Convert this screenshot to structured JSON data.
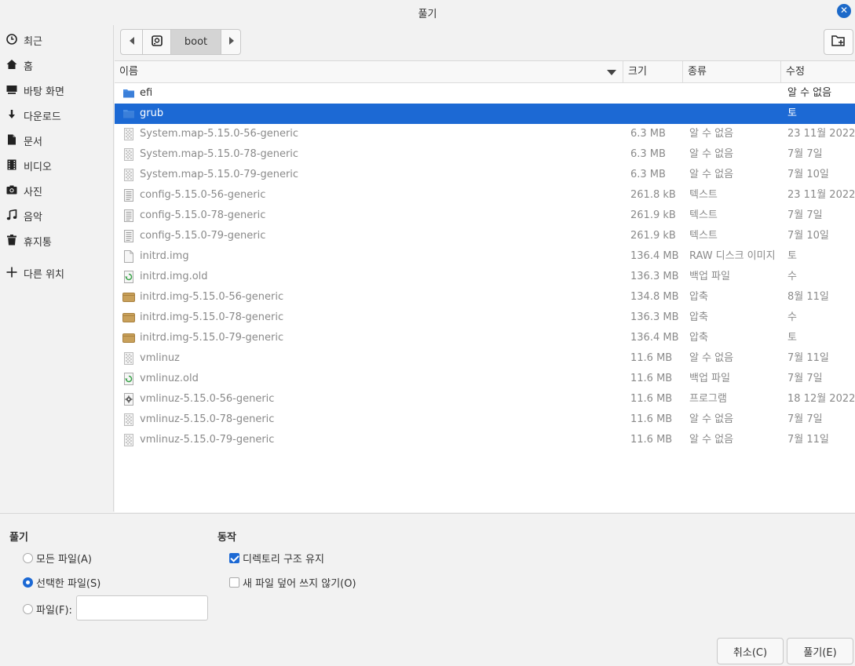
{
  "window": {
    "title": "풀기"
  },
  "sidebar": {
    "items": [
      {
        "label": "최근",
        "icon": "clock-icon"
      },
      {
        "label": "홈",
        "icon": "home-icon"
      },
      {
        "label": "바탕 화면",
        "icon": "desktop-icon"
      },
      {
        "label": "다운로드",
        "icon": "download-icon"
      },
      {
        "label": "문서",
        "icon": "document-icon"
      },
      {
        "label": "비디오",
        "icon": "video-icon"
      },
      {
        "label": "사진",
        "icon": "camera-icon"
      },
      {
        "label": "음악",
        "icon": "music-icon"
      },
      {
        "label": "휴지통",
        "icon": "trash-icon"
      },
      {
        "label": "다른 위치",
        "icon": "plus-icon"
      }
    ]
  },
  "pathbar": {
    "current": "boot"
  },
  "columns": {
    "name": "이름",
    "size": "크기",
    "type": "종류",
    "modified": "수정"
  },
  "files": [
    {
      "name": "efi",
      "size": "",
      "type": "",
      "modified": "알 수 없음",
      "icon": "folder-icon",
      "kind": "dir",
      "selected": false
    },
    {
      "name": "grub",
      "size": "",
      "type": "",
      "modified": "토",
      "icon": "folder-icon",
      "kind": "dir",
      "selected": true
    },
    {
      "name": "System.map-5.15.0-56-generic",
      "size": "6.3 MB",
      "type": "알 수 없음",
      "modified": "23 11월 2022",
      "icon": "unknown-file-icon",
      "kind": "file",
      "selected": false
    },
    {
      "name": "System.map-5.15.0-78-generic",
      "size": "6.3 MB",
      "type": "알 수 없음",
      "modified": " 7월 7일",
      "icon": "unknown-file-icon",
      "kind": "file",
      "selected": false
    },
    {
      "name": "System.map-5.15.0-79-generic",
      "size": "6.3 MB",
      "type": "알 수 없음",
      "modified": " 7월 10일",
      "icon": "unknown-file-icon",
      "kind": "file",
      "selected": false
    },
    {
      "name": "config-5.15.0-56-generic",
      "size": "261.8 kB",
      "type": "텍스트",
      "modified": "23 11월 2022",
      "icon": "text-file-icon",
      "kind": "file",
      "selected": false
    },
    {
      "name": "config-5.15.0-78-generic",
      "size": "261.9 kB",
      "type": "텍스트",
      "modified": " 7월 7일",
      "icon": "text-file-icon",
      "kind": "file",
      "selected": false
    },
    {
      "name": "config-5.15.0-79-generic",
      "size": "261.9 kB",
      "type": "텍스트",
      "modified": " 7월 10일",
      "icon": "text-file-icon",
      "kind": "file",
      "selected": false
    },
    {
      "name": "initrd.img",
      "size": "136.4 MB",
      "type": "RAW 디스크 이미지",
      "modified": "토",
      "icon": "blank-file-icon",
      "kind": "file",
      "selected": false
    },
    {
      "name": "initrd.img.old",
      "size": "136.3 MB",
      "type": "백업 파일",
      "modified": "수",
      "icon": "backup-file-icon",
      "kind": "file",
      "selected": false
    },
    {
      "name": "initrd.img-5.15.0-56-generic",
      "size": "134.8 MB",
      "type": "압축",
      "modified": " 8월 11일",
      "icon": "archive-icon",
      "kind": "file",
      "selected": false
    },
    {
      "name": "initrd.img-5.15.0-78-generic",
      "size": "136.3 MB",
      "type": "압축",
      "modified": "수",
      "icon": "archive-icon",
      "kind": "file",
      "selected": false
    },
    {
      "name": "initrd.img-5.15.0-79-generic",
      "size": "136.4 MB",
      "type": "압축",
      "modified": "토",
      "icon": "archive-icon",
      "kind": "file",
      "selected": false
    },
    {
      "name": "vmlinuz",
      "size": "11.6 MB",
      "type": "알 수 없음",
      "modified": " 7월 11일",
      "icon": "unknown-file-icon",
      "kind": "file",
      "selected": false
    },
    {
      "name": "vmlinuz.old",
      "size": "11.6 MB",
      "type": "백업 파일",
      "modified": " 7월 7일",
      "icon": "backup-file-icon",
      "kind": "file",
      "selected": false
    },
    {
      "name": "vmlinuz-5.15.0-56-generic",
      "size": "11.6 MB",
      "type": "프로그램",
      "modified": "18 12월 2022",
      "icon": "program-icon",
      "kind": "file",
      "selected": false
    },
    {
      "name": "vmlinuz-5.15.0-78-generic",
      "size": "11.6 MB",
      "type": "알 수 없음",
      "modified": " 7월 7일",
      "icon": "unknown-file-icon",
      "kind": "file",
      "selected": false
    },
    {
      "name": "vmlinuz-5.15.0-79-generic",
      "size": "11.6 MB",
      "type": "알 수 없음",
      "modified": " 7월 11일",
      "icon": "unknown-file-icon",
      "kind": "file",
      "selected": false
    }
  ],
  "extract": {
    "title": "풀기",
    "all_files": "모든 파일(A)",
    "selected_files": "선택한 파일(S)",
    "files": "파일(F):",
    "files_value": "",
    "selected_option": "selected_files"
  },
  "actions": {
    "title": "동작",
    "keep_dirs": "디렉토리 구조 유지",
    "keep_dirs_checked": true,
    "no_overwrite": "새 파일 덮어 쓰지 않기(O)",
    "no_overwrite_checked": false
  },
  "buttons": {
    "cancel": "취소(C)",
    "extract": "풀기(E)"
  },
  "colors": {
    "accent": "#1c69d4",
    "folder": "#4a8ee4",
    "archive": "#c8a05a"
  }
}
